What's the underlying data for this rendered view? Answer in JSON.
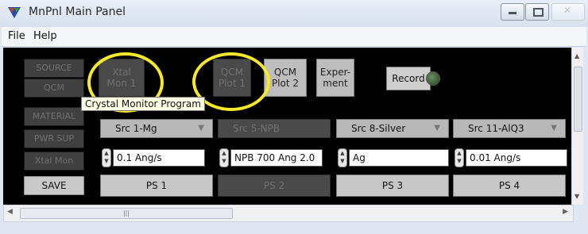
{
  "window": {
    "title": "MnPnl Main Panel"
  },
  "menu": {
    "file": "File",
    "help": "Help"
  },
  "nav": [
    "SOURCE",
    "QCM",
    "MATERIAL",
    "PWR SUP",
    "Xtal Mon",
    "SAVE"
  ],
  "top_buttons": {
    "xtal_mon_1": "Xtal\nMon 1",
    "qcm_plot_1": "QCM\nPlot 1",
    "qcm_plot_2": "QCM\nPlot 2",
    "experiment": "Exper-\nment",
    "record": "Record"
  },
  "tooltip": "Crystal Monitor Program",
  "sources": [
    {
      "name": "Src 1-Mg",
      "rate": "0.1 Ang/s",
      "ps": "PS 1",
      "enabled": true
    },
    {
      "name": "Src 5-NPB",
      "rate": "NPB 700 Ang 2.0",
      "ps": "PS 2",
      "enabled": false
    },
    {
      "name": "Src 8-Silver",
      "rate": "Ag",
      "ps": "PS 3",
      "enabled": true
    },
    {
      "name": "Src 11-AlQ3",
      "rate": "0.01 Ang/s",
      "ps": "PS 4",
      "enabled": true
    }
  ],
  "colors": {
    "highlight_circle": "#f7e82a",
    "panel_bg": "#000000"
  },
  "icons": [
    "app-icon",
    "minimize-icon",
    "maximize-icon",
    "close-icon",
    "dropdown-arrow-icon",
    "stepper-icon",
    "led-indicator-icon"
  ]
}
